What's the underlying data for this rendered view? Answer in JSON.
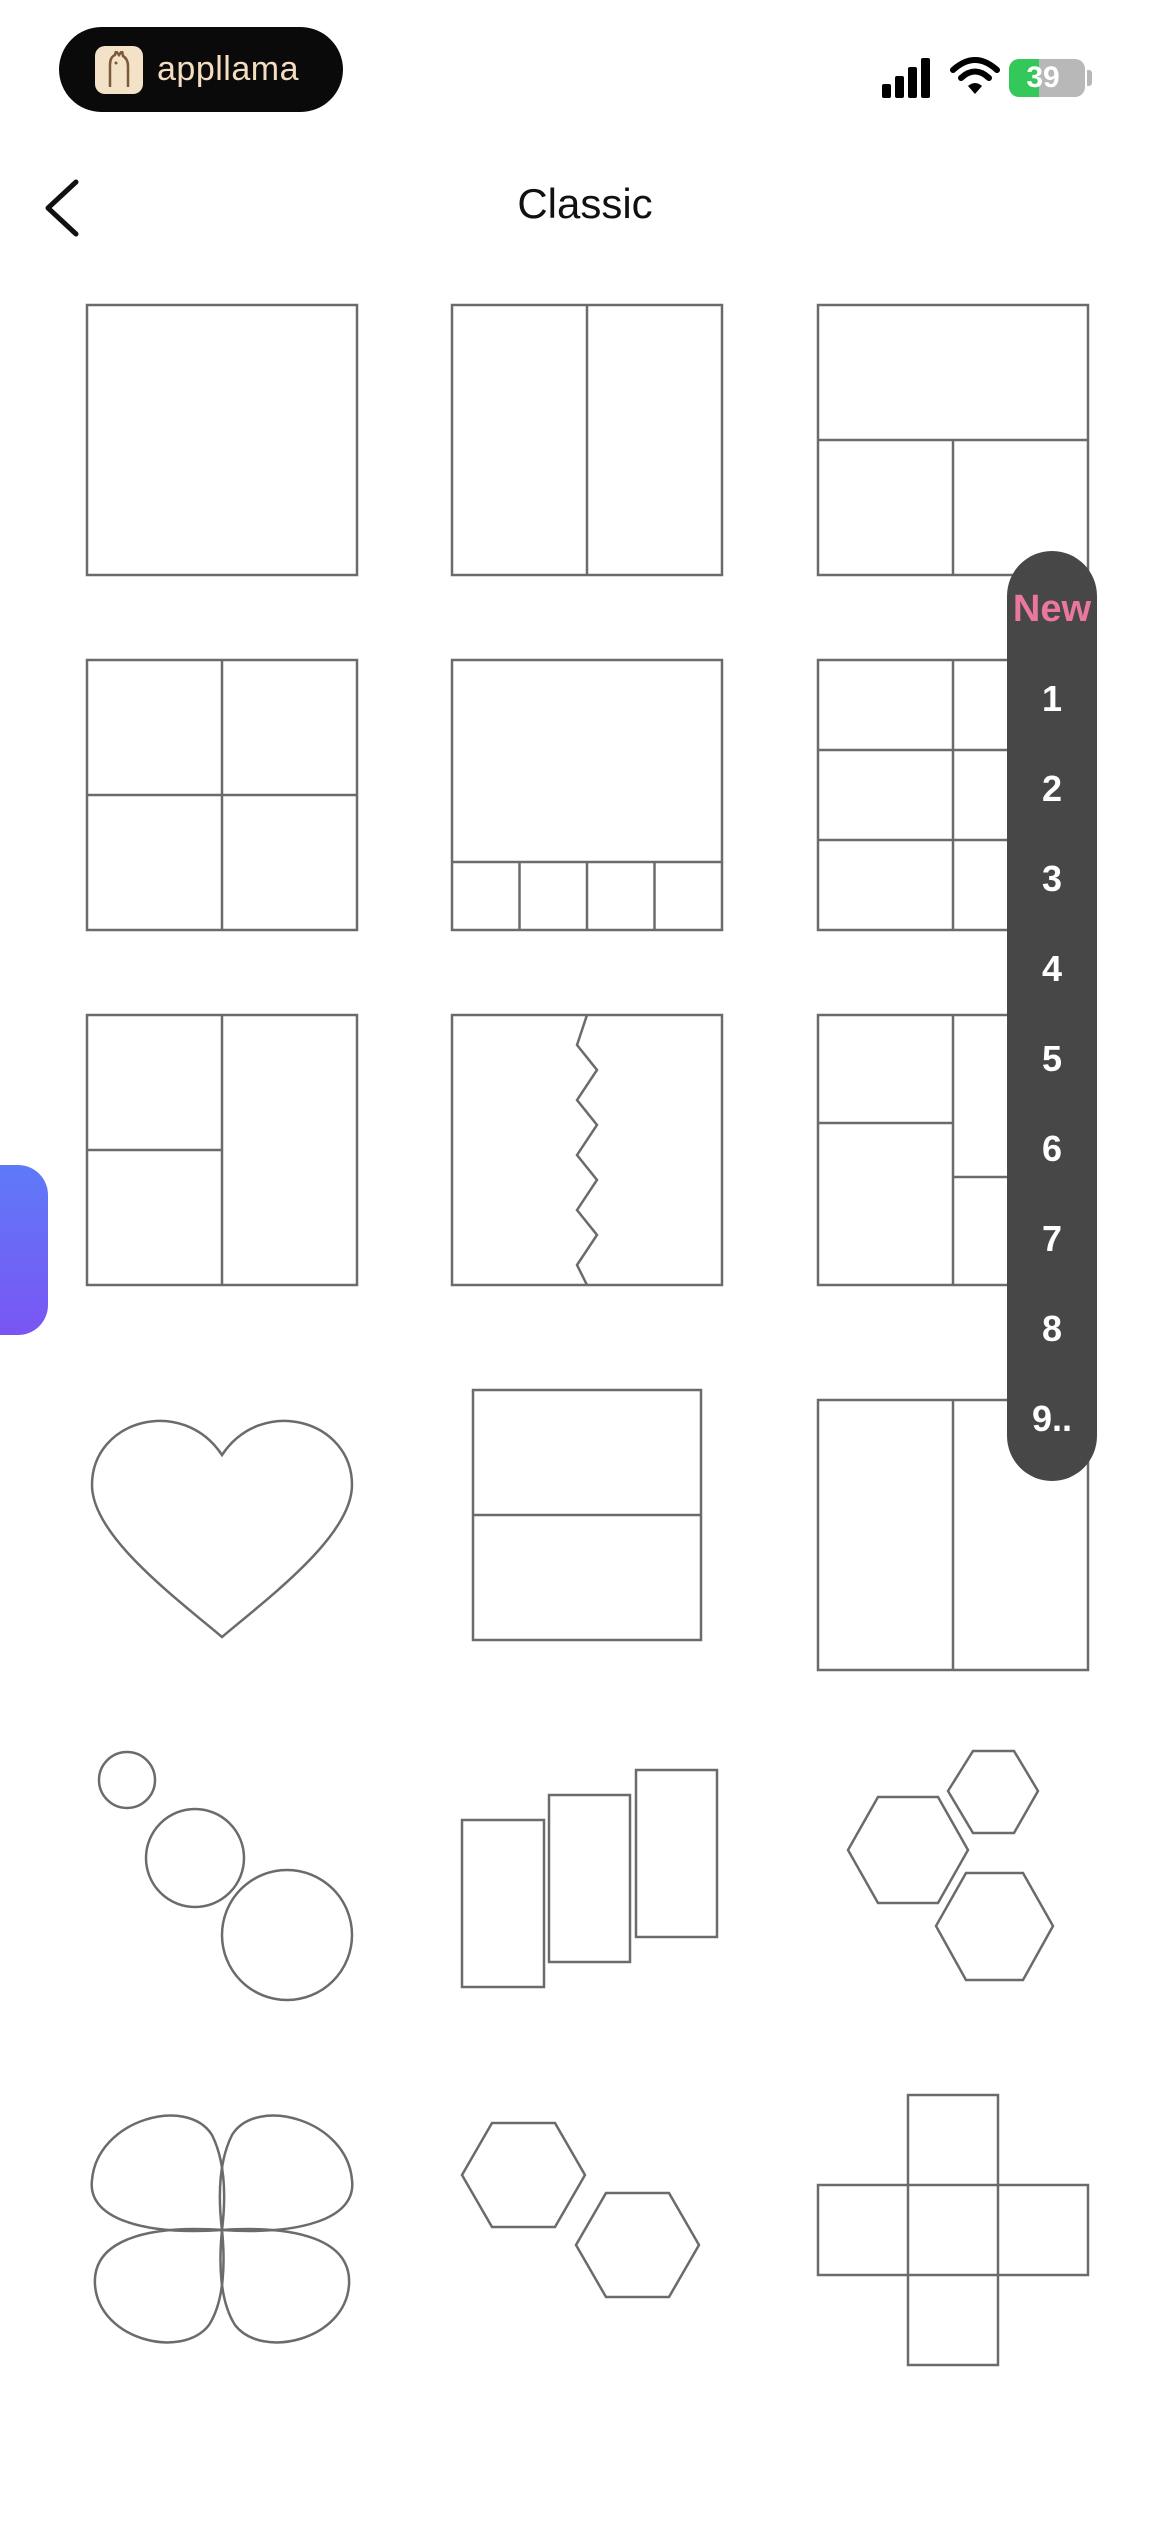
{
  "status_bar": {
    "app_name": "appllama",
    "battery_level": 39,
    "battery_text": "39",
    "signal_icon": "cellular-signal-icon",
    "wifi_icon": "wifi-icon",
    "battery_color": "#34c759"
  },
  "header": {
    "title": "Classic",
    "back_icon": "chevron-left-icon"
  },
  "index": {
    "items": [
      "New",
      "1",
      "2",
      "3",
      "4",
      "5",
      "6",
      "7",
      "8",
      "9.."
    ],
    "new_color": "#e9779f",
    "background": "#474747"
  },
  "layouts": [
    "single",
    "two-columns",
    "top-wide-two-bottom",
    "four-grid",
    "large-top-four-bottom",
    "three-rows-two-columns",
    "two-left-one-right",
    "zigzag-split",
    "left-two-right-two-offset",
    "heart",
    "two-rows",
    "two-columns-tall",
    "three-circles",
    "staggered-columns",
    "three-hexagons",
    "four-petal-flower",
    "two-hexagons",
    "cross"
  ],
  "side_tab_color": "#6a6af6"
}
